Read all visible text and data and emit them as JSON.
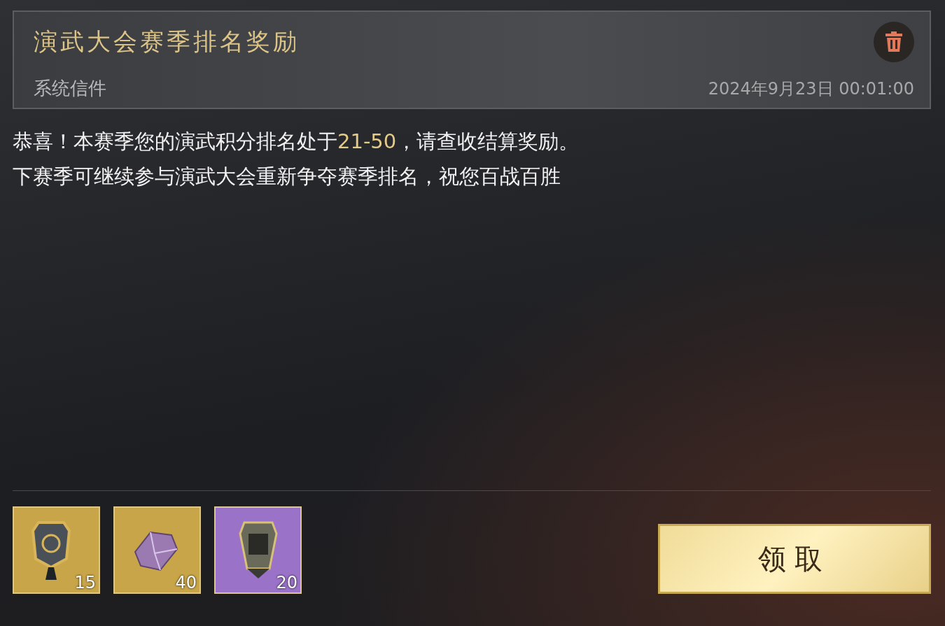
{
  "mail": {
    "title": "演武大会赛季排名奖励",
    "sender": "系统信件",
    "date": "2024年9月23日 00:01:00"
  },
  "body": [
    "恭喜！本赛季您的演武积分排名处于**21-50**，请查收结算奖励。",
    "下赛季可继续参与演武大会重新争夺赛季排名，祝您百战百胜"
  ],
  "rewards": [
    {
      "kind": "token",
      "count": "15",
      "color": "#c8a548"
    },
    {
      "kind": "crystal",
      "count": "40",
      "color": "#c8a548"
    },
    {
      "kind": "plaque",
      "count": "20",
      "color": "#9a72c8"
    }
  ],
  "claim_button": "领取"
}
